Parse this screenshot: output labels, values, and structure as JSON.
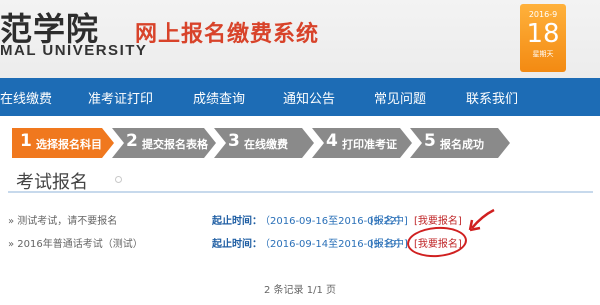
{
  "header": {
    "school_name": "范学院",
    "school_name_en": "MAL UNIVERSITY",
    "system_title": "网上报名缴费系统",
    "date": {
      "year_month": "2016-9",
      "day": "18",
      "weekday": "星期天"
    }
  },
  "nav": {
    "items": [
      {
        "label": "在线缴费"
      },
      {
        "label": "准考证打印"
      },
      {
        "label": "成绩查询"
      },
      {
        "label": "通知公告"
      },
      {
        "label": "常见问题"
      },
      {
        "label": "联系我们"
      }
    ]
  },
  "steps": [
    {
      "num": "1",
      "label": "选择报名科目",
      "active": true
    },
    {
      "num": "2",
      "label": "提交报名表格",
      "active": false
    },
    {
      "num": "3",
      "label": "在线缴费",
      "active": false
    },
    {
      "num": "4",
      "label": "打印准考证",
      "active": false
    },
    {
      "num": "5",
      "label": "报名成功",
      "active": false
    }
  ],
  "colors": {
    "active_step": "#f0781e",
    "inactive_step": "#8a8a8a",
    "nav": "#1d6cb5",
    "annotation": "#d02020"
  },
  "section": {
    "title": "考试报名"
  },
  "exams": [
    {
      "title": "» 测试考试，请不要报名",
      "start_label": "起止时间：",
      "range": "（2016-09-16至2016-09-22）",
      "status": "[报名中]",
      "action": "[我要报名]"
    },
    {
      "title": "» 2016年普通话考试（测试）",
      "start_label": "起止时间：",
      "range": "（2016-09-14至2016-09-19）",
      "status": "[报名中]",
      "action": "[我要报名]"
    }
  ],
  "pager": {
    "text": "2 条记录 1/1 页"
  }
}
